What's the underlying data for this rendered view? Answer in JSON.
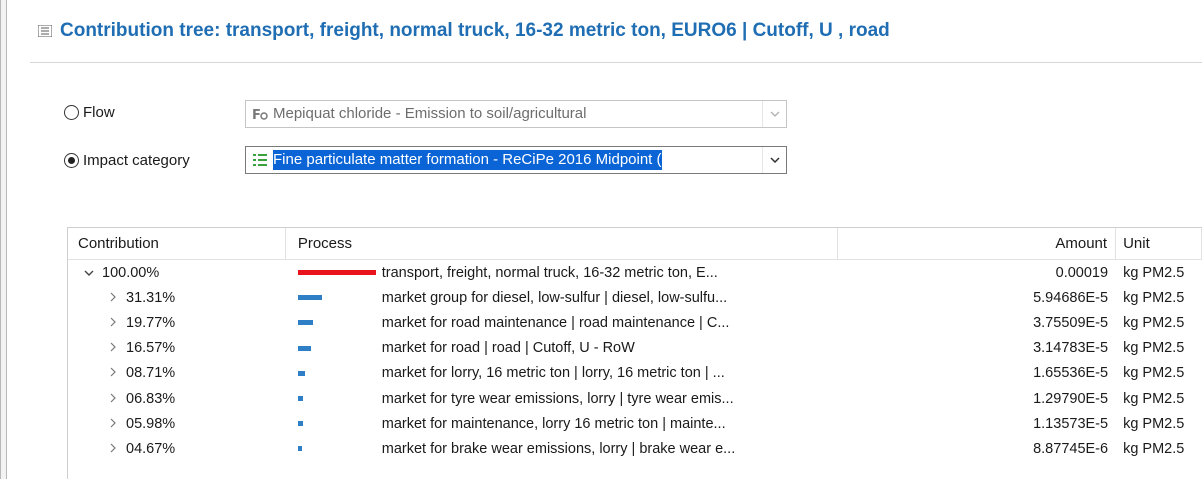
{
  "header": {
    "title": "Contribution tree:  transport, freight, normal truck, 16-32 metric ton, EURO6 | Cutoff, U , road"
  },
  "selector": {
    "flow_label": "Flow",
    "flow_value": "Mepiquat chloride - Emission to soil/agricultural",
    "flow_selected": false,
    "impact_label": "Impact category",
    "impact_value": "Fine particulate matter formation - ReCiPe 2016 Midpoint (",
    "impact_selected": true
  },
  "table": {
    "headers": {
      "contribution": "Contribution",
      "process": "Process",
      "amount": "Amount",
      "unit": "Unit"
    },
    "rows": [
      {
        "contribution": "100.00%",
        "process": "transport, freight, normal truck, 16-32 metric ton, E...",
        "amount": "0.00019",
        "unit": "kg PM2.5",
        "share": 1.0,
        "expanded": true,
        "bar_color": "#e8131b"
      },
      {
        "contribution": "31.31%",
        "process": "market group for diesel, low-sulfur | diesel, low-sulfu...",
        "amount": "5.94686E-5",
        "unit": "kg PM2.5",
        "share": 0.3131,
        "expanded": false,
        "bar_color": "#2f7fc6"
      },
      {
        "contribution": "19.77%",
        "process": "market for road maintenance | road maintenance | C...",
        "amount": "3.75509E-5",
        "unit": "kg PM2.5",
        "share": 0.1977,
        "expanded": false,
        "bar_color": "#2f7fc6"
      },
      {
        "contribution": "16.57%",
        "process": "market for road | road | Cutoff, U - RoW",
        "amount": "3.14783E-5",
        "unit": "kg PM2.5",
        "share": 0.1657,
        "expanded": false,
        "bar_color": "#2f7fc6"
      },
      {
        "contribution": "08.71%",
        "process": "market for lorry, 16 metric ton | lorry, 16 metric ton | ...",
        "amount": "1.65536E-5",
        "unit": "kg PM2.5",
        "share": 0.0871,
        "expanded": false,
        "bar_color": "#2f7fc6"
      },
      {
        "contribution": "06.83%",
        "process": "market for tyre wear emissions, lorry | tyre wear emis...",
        "amount": "1.29790E-5",
        "unit": "kg PM2.5",
        "share": 0.0683,
        "expanded": false,
        "bar_color": "#2f7fc6"
      },
      {
        "contribution": "05.98%",
        "process": "market for maintenance, lorry 16 metric ton | mainte...",
        "amount": "1.13573E-5",
        "unit": "kg PM2.5",
        "share": 0.0598,
        "expanded": false,
        "bar_color": "#2f7fc6"
      },
      {
        "contribution": "04.67%",
        "process": "market for brake wear emissions, lorry | brake wear e...",
        "amount": "8.87745E-6",
        "unit": "kg PM2.5",
        "share": 0.0467,
        "expanded": false,
        "bar_color": "#2f7fc6"
      }
    ]
  },
  "icons": {
    "header": "tree-view-icon",
    "flow_field": "flow-icon",
    "impact_field": "impact-category-icon",
    "dropdown": "chevron-down-icon",
    "expand": "chevron-right-icon",
    "collapse": "chevron-down-icon"
  },
  "colors": {
    "accent": "#1f6db3",
    "selection": "#0a64d6",
    "root_bar": "#e8131b",
    "child_bar": "#2f7fc6"
  }
}
